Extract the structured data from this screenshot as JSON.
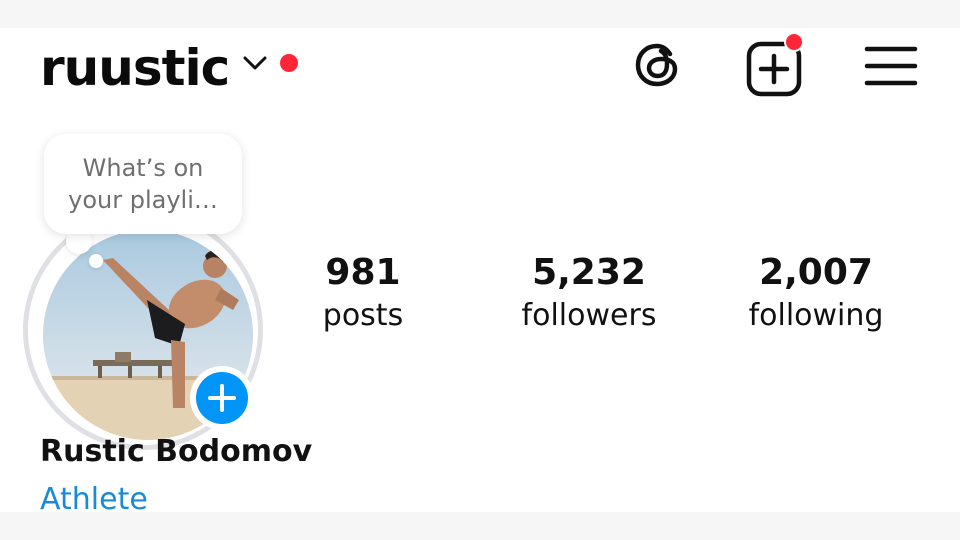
{
  "header": {
    "username": "ruustic",
    "icons": [
      "chevron-down-icon",
      "threads-icon",
      "create-post-icon",
      "menu-icon"
    ],
    "notification_color": "#ff2637"
  },
  "profile": {
    "note": "What’s on your playli…",
    "full_name": "Rustic Bodomov",
    "category": "Athlete",
    "category_color": "#1b8ad6",
    "add_story_color": "#0095f6"
  },
  "stats": {
    "posts": {
      "value": "981",
      "label": "posts"
    },
    "followers": {
      "value": "5,232",
      "label": "followers"
    },
    "following": {
      "value": "2,007",
      "label": "following"
    }
  }
}
